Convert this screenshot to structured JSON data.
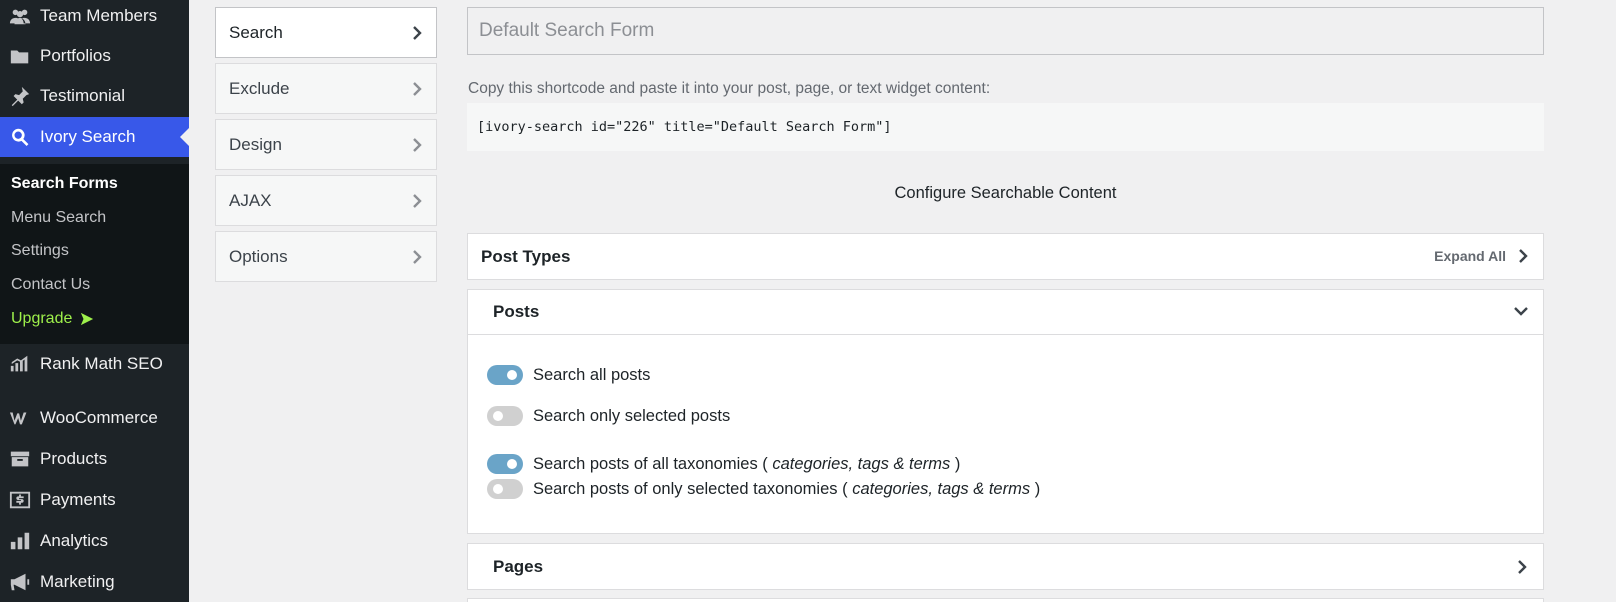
{
  "sidebar": {
    "items_top": [
      {
        "label": "Team Members",
        "icon": "team-members-icon"
      },
      {
        "label": "Portfolios",
        "icon": "folder-icon"
      },
      {
        "label": "Testimonial",
        "icon": "pin-icon"
      },
      {
        "label": "Ivory Search",
        "icon": "search-icon"
      }
    ],
    "submenu": [
      {
        "label": "Search Forms"
      },
      {
        "label": "Menu Search"
      },
      {
        "label": "Settings"
      },
      {
        "label": "Contact Us"
      },
      {
        "label": "Upgrade"
      }
    ],
    "items_bottom": [
      {
        "label": "Rank Math SEO",
        "icon": "rank-math-icon"
      },
      {
        "label": "WooCommerce",
        "icon": "woocommerce-icon"
      },
      {
        "label": "Products",
        "icon": "archive-box-icon"
      },
      {
        "label": "Payments",
        "icon": "dollar-icon"
      },
      {
        "label": "Analytics",
        "icon": "bar-chart-icon"
      },
      {
        "label": "Marketing",
        "icon": "megaphone-icon"
      }
    ],
    "accent_color": "#3858e9",
    "upgrade_color": "#9ef04b"
  },
  "tabs": [
    {
      "label": "Search"
    },
    {
      "label": "Exclude"
    },
    {
      "label": "Design"
    },
    {
      "label": "AJAX"
    },
    {
      "label": "Options"
    }
  ],
  "form": {
    "title_placeholder": "Default Search Form",
    "shortcode_label": "Copy this shortcode and paste it into your post, page, or text widget content:",
    "shortcode": "[ivory-search id=\"226\" title=\"Default Search Form\"]",
    "configure_heading": "Configure Searchable Content"
  },
  "post_types": {
    "title": "Post Types",
    "expand_all": "Expand All"
  },
  "posts": {
    "title": "Posts",
    "options": [
      {
        "label": "Search all posts",
        "enabled": true
      },
      {
        "label": "Search only selected posts",
        "enabled": false
      },
      {
        "label": "Search posts of all taxonomies (",
        "italic": "categories, tags & terms",
        "after": ")",
        "enabled": true
      },
      {
        "label": "Search posts of only selected taxonomies (",
        "italic": "categories, tags & terms",
        "after": ")",
        "enabled": false
      }
    ],
    "toggle_on_color": "#6aa4c8"
  },
  "pages": {
    "title": "Pages"
  }
}
